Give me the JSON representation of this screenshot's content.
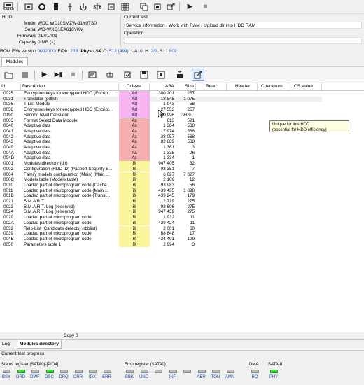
{
  "toolbar": {
    "logo_label": "SATA0"
  },
  "hdd": {
    "title": "HDD",
    "fields": [
      {
        "label": "Model",
        "value": "WDC WD10SMZW-11Y0TS0"
      },
      {
        "label": "Serial",
        "value": "WD-WXQ1EA616YKV"
      },
      {
        "label": "Firmware",
        "value": "01.01A01"
      },
      {
        "label": "Capacity",
        "value": "0 MB (1)"
      }
    ]
  },
  "current_test": {
    "title": "Current test",
    "value": "Service information / Work with RAM / Upload dir into HDD RAM",
    "operation_title": "Operation",
    "operation_value": "-"
  },
  "rom": {
    "label": "ROM F/W version",
    "version": "0002000/",
    "fidir_label": "FIDir:",
    "fidir": "20B",
    "phys_label": "Phys - SA C:",
    "phys": "512 (499)",
    "ua_label": "UA:",
    "ua": "0",
    "h_label": "H:",
    "h": "2/2",
    "s_label": "S:",
    "s": "1 909"
  },
  "tabs": {
    "modules": "Modules"
  },
  "grid": {
    "columns": [
      "Id",
      "Description",
      "Cr.level",
      "ABA",
      "Size",
      "Read",
      "Header",
      "Checksum",
      "CS Value"
    ],
    "rows": [
      {
        "id": "0025",
        "desc": "Encryption keys for encrypted HDD (Encript...",
        "lvl": "Ad",
        "aba": "380 201",
        "size": "257"
      },
      {
        "id": "0031",
        "desc": "Translator (pdlist)",
        "lvl": "Ad",
        "aba": "18 545",
        "size": "1 075"
      },
      {
        "id": "0036",
        "desc": "T-List Module",
        "lvl": "Ad",
        "aba": "1 943",
        "size": "58"
      },
      {
        "id": "0038",
        "desc": "Encryption keys for encrypted HDD (Encript...",
        "lvl": "Ad",
        "aba": "27 553",
        "size": "257"
      },
      {
        "id": "0190",
        "desc": "Second level translator",
        "lvl": "Ad",
        "aba": "160 996",
        "size": "198 9..."
      },
      {
        "id": "0003",
        "desc": "Format Select Data Module",
        "lvl": "As",
        "aba": "813",
        "size": "521"
      },
      {
        "id": "0040",
        "desc": "Adaptive data",
        "lvl": "As",
        "aba": "1 364",
        "size": "568"
      },
      {
        "id": "0041",
        "desc": "Adaptive data",
        "lvl": "As",
        "aba": "17 974",
        "size": "568"
      },
      {
        "id": "0042",
        "desc": "Adaptive data",
        "lvl": "As",
        "aba": "38 057",
        "size": "568"
      },
      {
        "id": "0043",
        "desc": "Adaptive data",
        "lvl": "As",
        "aba": "82 889",
        "size": "568"
      },
      {
        "id": "0049",
        "desc": "Adaptive data",
        "lvl": "As",
        "aba": "1 361",
        "size": "3"
      },
      {
        "id": "004A",
        "desc": "Adaptive data",
        "lvl": "As",
        "aba": "1 335",
        "size": "26"
      },
      {
        "id": "004D",
        "desc": "Adaptive data",
        "lvl": "As",
        "aba": "1 334",
        "size": "1"
      },
      {
        "id": "0001",
        "desc": "Modules directory (dir)",
        "lvl": "B",
        "aba": "947 405",
        "size": "32"
      },
      {
        "id": "0002",
        "desc": "Configuration (HDD ID) (Pasport Sequrity B...",
        "lvl": "B",
        "aba": "93 351",
        "size": "7"
      },
      {
        "id": "0004",
        "desc": "Family models configuration (Main) (Main ...",
        "lvl": "B",
        "aba": "6 627",
        "size": "7 027"
      },
      {
        "id": "000C",
        "desc": "Models table (Models table)",
        "lvl": "B",
        "aba": "2 109",
        "size": "12"
      },
      {
        "id": "0010",
        "desc": "Loaded part of microprogram code (Cache ...",
        "lvl": "B",
        "aba": "93 983",
        "size": "56"
      },
      {
        "id": "0011",
        "desc": "Loaded part of microprogram code (Main ...",
        "lvl": "B",
        "aba": "439 435",
        "size": "1 898"
      },
      {
        "id": "001B",
        "desc": "Loaded part of microprogram code (Transi...",
        "lvl": "B",
        "aba": "439 245",
        "size": "179"
      },
      {
        "id": "0021",
        "desc": "S.M.A.R.T.",
        "lvl": "B",
        "aba": "2 719",
        "size": "275"
      },
      {
        "id": "0023",
        "desc": "S.M.A.R.T. Log (reserved)",
        "lvl": "B",
        "aba": "93 606",
        "size": "275"
      },
      {
        "id": "0024",
        "desc": "S.M.A.R.T. Log (reserved)",
        "lvl": "B",
        "aba": "947 439",
        "size": "275"
      },
      {
        "id": "0029",
        "desc": "Loaded part of microprogram code",
        "lvl": "B",
        "aba": "1 932",
        "size": "11"
      },
      {
        "id": "002A",
        "desc": "Loaded part of microprogram code",
        "lvl": "B",
        "aba": "439 424",
        "size": "11"
      },
      {
        "id": "0032",
        "desc": "Relo-List (Candidate defects) (rbblist)",
        "lvl": "B",
        "aba": "2 001",
        "size": "60"
      },
      {
        "id": "0039",
        "desc": "Loaded part of microprogram code",
        "lvl": "B",
        "aba": "88 848",
        "size": "17"
      },
      {
        "id": "004B",
        "desc": "Loaded part of microprogram code",
        "lvl": "B",
        "aba": "434 491",
        "size": "109"
      },
      {
        "id": "0050",
        "desc": "Parameters table 1",
        "lvl": "B",
        "aba": "2 994",
        "size": "3"
      }
    ]
  },
  "tooltip": {
    "line1": "Unique for this HDD",
    "line2": "(essential for HDD efficiency)"
  },
  "level_colors": {
    "Ad": "#f6b4f0",
    "As": "#f7b0b0",
    "B": "#fbf69e"
  },
  "copy_bar": {
    "label": "Copy 0"
  },
  "bottom_tabs": [
    "Log",
    "Modules directory"
  ],
  "progress": {
    "label": "Current test progress"
  },
  "status": {
    "status_title": "Status register (SATA0)-[PIO4]",
    "status_leds": [
      {
        "name": "BSY",
        "on": false
      },
      {
        "name": "DRD",
        "on": true
      },
      {
        "name": "DWF",
        "on": false
      },
      {
        "name": "DSC",
        "on": true
      },
      {
        "name": "DRQ",
        "on": false
      },
      {
        "name": "CRR",
        "on": false
      },
      {
        "name": "IDX",
        "on": false
      },
      {
        "name": "ERR",
        "on": false
      }
    ],
    "error_title": "Error register (SATA0)",
    "error_leds": [
      "BBK",
      "UNC",
      "",
      "INF",
      "",
      "ABR",
      "TON",
      "AMN"
    ],
    "dma_title": "DMA",
    "dma_led": "RQ",
    "sata_title": "SATA-II",
    "sata_led": "PHY",
    "green": "#33dd33"
  }
}
